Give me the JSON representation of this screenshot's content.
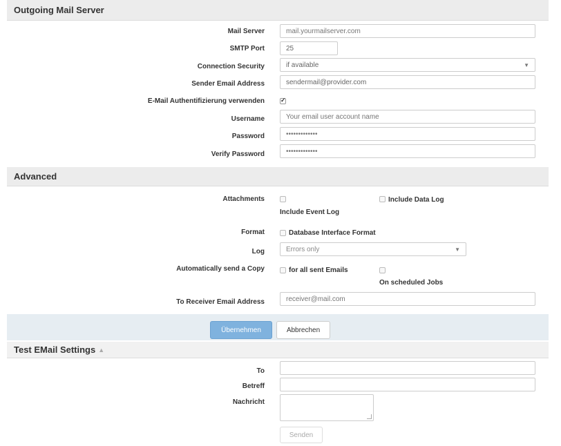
{
  "outgoing": {
    "title": "Outgoing Mail Server",
    "mail_server_label": "Mail Server",
    "mail_server_placeholder": "mail.yourmailserver.com",
    "smtp_port_label": "SMTP Port",
    "smtp_port_value": "25",
    "security_label": "Connection Security",
    "security_value": "if available",
    "sender_label": "Sender Email Address",
    "sender_value": "sendermail@provider.com",
    "auth_label": "E-Mail Authentifizierung verwenden",
    "username_label": "Username",
    "username_placeholder": "Your email user account name",
    "password_label": "Password",
    "password_value": "•••••••••••••",
    "verify_label": "Verify Password",
    "verify_value": "•••••••••••••"
  },
  "advanced": {
    "title": "Advanced",
    "attachments_label": "Attachments",
    "include_data_log": "Include Data Log",
    "include_event_log": "Include Event Log",
    "format_label": "Format",
    "db_interface_format": "Database Interface Format",
    "log_label": "Log",
    "log_value": "Errors only",
    "auto_copy_label": "Automatically send a Copy",
    "for_all_sent": "for all sent Emails",
    "on_scheduled": "On scheduled Jobs",
    "receiver_label": "To Receiver Email Address",
    "receiver_value": "receiver@mail.com"
  },
  "buttons": {
    "apply": "Übernehmen",
    "cancel": "Abbrechen"
  },
  "test": {
    "title": "Test EMail Settings",
    "to_label": "To",
    "subject_label": "Betreff",
    "message_label": "Nachricht",
    "send": "Senden"
  }
}
